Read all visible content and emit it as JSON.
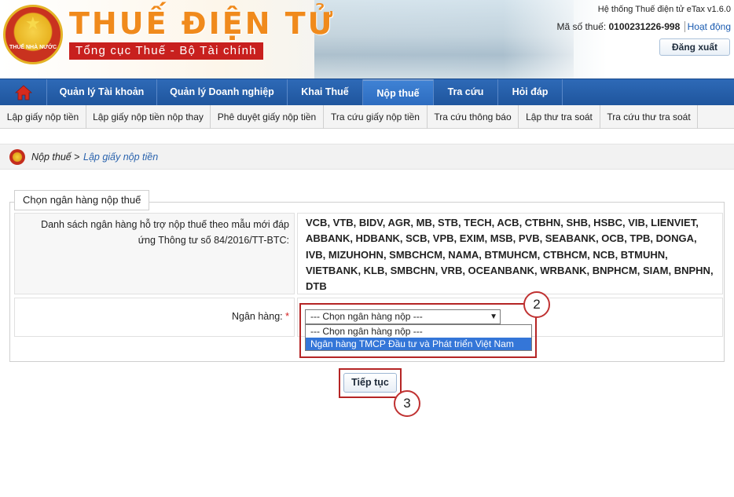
{
  "header": {
    "emblem_text": "THUẾ NHÀ NƯỚC",
    "title": "THUẾ ĐIỆN TỬ",
    "subtitle": "Tổng cục Thuế - Bộ Tài chính",
    "system_name": "Hệ thống Thuế điện tử eTax v1.6.0",
    "tax_id_label": "Mã số thuế:",
    "tax_id_value": "0100231226-998",
    "activity_link": "Hoạt động",
    "logout_label": "Đăng xuất"
  },
  "main_nav": {
    "items": [
      {
        "label": "Quản lý Tài khoản"
      },
      {
        "label": "Quản lý Doanh nghiệp"
      },
      {
        "label": "Khai Thuế"
      },
      {
        "label": "Nộp thuế"
      },
      {
        "label": "Tra cứu"
      },
      {
        "label": "Hỏi đáp"
      }
    ],
    "active": "Nộp thuế"
  },
  "sub_nav": {
    "items": [
      {
        "label": "Lập giấy nộp tiền"
      },
      {
        "label": "Lập giấy nộp tiền nộp thay"
      },
      {
        "label": "Phê duyệt giấy nộp tiền"
      },
      {
        "label": "Tra cứu giấy nộp tiền"
      },
      {
        "label": "Tra cứu thông báo"
      },
      {
        "label": "Lập thư tra soát"
      },
      {
        "label": "Tra cứu thư tra soát"
      }
    ]
  },
  "breadcrumb": {
    "parent": "Nộp thuế",
    "separator": ">",
    "current": "Lập giấy nộp tiền"
  },
  "form": {
    "legend": "Chọn ngân hàng nộp thuế",
    "banks_label": "Danh sách ngân hàng hỗ trợ nộp thuế theo mẫu mới đáp ứng Thông tư số 84/2016/TT-BTC:",
    "banks_list": "VCB, VTB, BIDV, AGR, MB, STB, TECH, ACB, CTBHN, SHB, HSBC, VIB, LIENVIET, ABBANK, HDBANK, SCB, VPB, EXIM, MSB, PVB, SEABANK, OCB, TPB, DONGA, IVB, MIZUHOHN, SMBCHCM, NAMA, BTMUHCM, CTBHCM, NCB, BTMUHN, VIETBANK, KLB, SMBCHN, VRB, OCEANBANK, WRBANK, BNPHCM, SIAM, BNPHN, DTB",
    "bank_field_label": "Ngân hàng:",
    "required_mark": "*",
    "bank_select_value": "--- Chọn ngân hàng nộp ---",
    "bank_options": [
      "--- Chọn ngân hàng nộp ---",
      "Ngân hàng TMCP Đầu tư và Phát triển Việt Nam"
    ],
    "continue_label": "Tiếp tục"
  },
  "annotations": {
    "step_2": "2",
    "step_3": "3",
    "callout_color": "#b52525"
  },
  "colors": {
    "nav_blue": "#1f559d",
    "brand_orange": "#f08a1c",
    "brand_red": "#c8201e",
    "selected_option": "#3476d8"
  }
}
